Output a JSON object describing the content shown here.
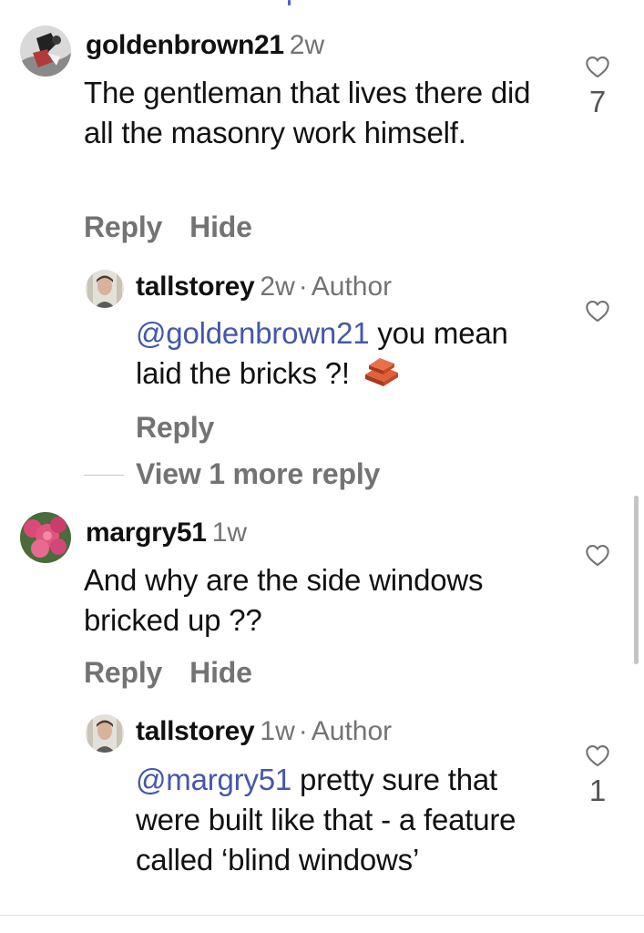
{
  "comments": [
    {
      "username": "goldenbrown21",
      "time": "2w",
      "text": "The gentleman that lives there did all the masonry work himself.",
      "reply_label": "Reply",
      "hide_label": "Hide",
      "like_count": "7"
    },
    {
      "username": "tallstorey",
      "time": "2w",
      "dot": "·",
      "author_label": "Author",
      "mention": "@goldenbrown21",
      "text": " you mean laid the bricks ?!",
      "emoji": "🧱",
      "reply_label": "Reply",
      "view_more_label": "View 1 more reply"
    },
    {
      "username": "margry51",
      "time": "1w",
      "text": "And why are the side windows bricked up ??",
      "reply_label": "Reply",
      "hide_label": "Hide"
    },
    {
      "username": "tallstorey",
      "time": "1w",
      "dot": "·",
      "author_label": "Author",
      "mention": "@margry51",
      "text": " pretty sure that were built like that - a feature called ‘blind windows’",
      "like_count": "1"
    }
  ],
  "icons": {
    "like": "heart-outline-icon",
    "emoji": "brick-emoji-icon"
  },
  "colors": {
    "mention": "#4458a8",
    "secondary_text": "#737373",
    "primary_text": "#111111"
  }
}
